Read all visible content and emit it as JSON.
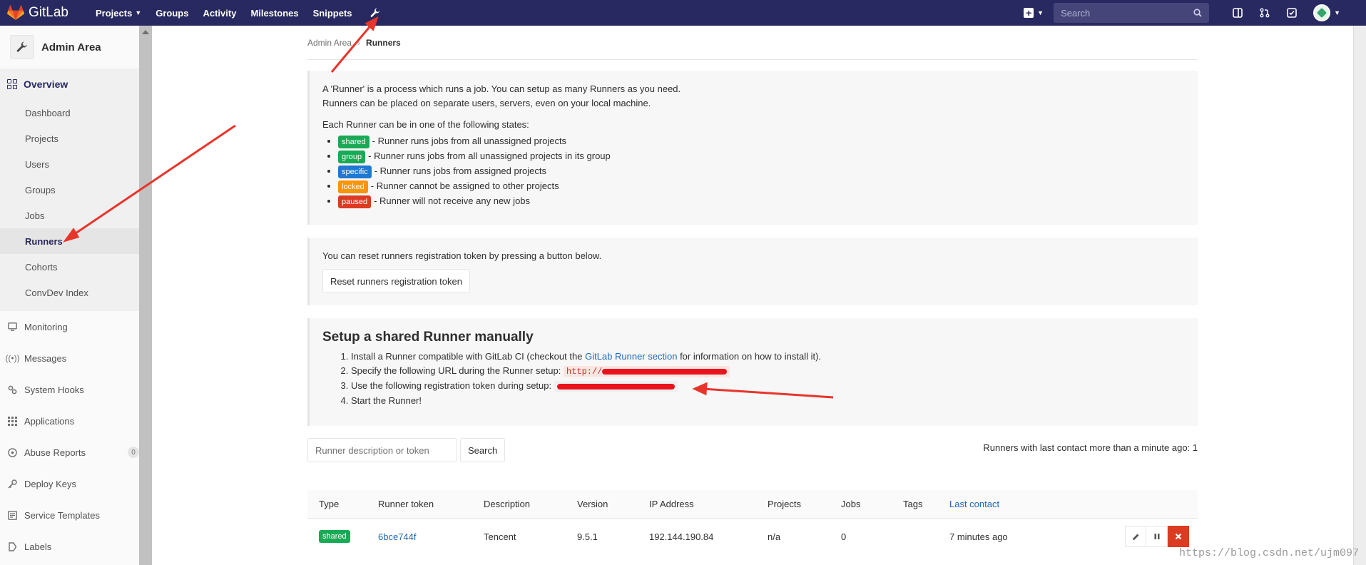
{
  "navbar": {
    "logo_text": "GitLab",
    "links": [
      {
        "label": "Projects",
        "dropdown": true
      },
      {
        "label": "Groups",
        "dropdown": false
      },
      {
        "label": "Activity",
        "dropdown": false
      },
      {
        "label": "Milestones",
        "dropdown": false
      },
      {
        "label": "Snippets",
        "dropdown": false
      }
    ],
    "search_placeholder": "Search"
  },
  "sidebar": {
    "title": "Admin Area",
    "overview_label": "Overview",
    "overview_items": [
      "Dashboard",
      "Projects",
      "Users",
      "Groups",
      "Jobs",
      "Runners",
      "Cohorts",
      "ConvDev Index"
    ],
    "active_item": "Runners",
    "items": [
      {
        "label": "Monitoring",
        "icon": "monitor-icon"
      },
      {
        "label": "Messages",
        "icon": "broadcast-icon"
      },
      {
        "label": "System Hooks",
        "icon": "hook-icon"
      },
      {
        "label": "Applications",
        "icon": "grid-icon"
      },
      {
        "label": "Abuse Reports",
        "icon": "warning-icon",
        "badge": "0"
      },
      {
        "label": "Deploy Keys",
        "icon": "key-icon"
      },
      {
        "label": "Service Templates",
        "icon": "template-icon"
      },
      {
        "label": "Labels",
        "icon": "label-icon"
      }
    ]
  },
  "breadcrumb": {
    "parent": "Admin Area",
    "current": "Runners"
  },
  "intro": {
    "line1": "A 'Runner' is a process which runs a job. You can setup as many Runners as you need.",
    "line2": "Runners can be placed on separate users, servers, even on your local machine.",
    "states_heading": "Each Runner can be in one of the following states:",
    "states": [
      {
        "label": "shared",
        "desc": "- Runner runs jobs from all unassigned projects"
      },
      {
        "label": "group",
        "desc": "- Runner runs jobs from all unassigned projects in its group"
      },
      {
        "label": "specific",
        "desc": "- Runner runs jobs from assigned projects"
      },
      {
        "label": "locked",
        "desc": "- Runner cannot be assigned to other projects"
      },
      {
        "label": "paused",
        "desc": "- Runner will not receive any new jobs"
      }
    ]
  },
  "reset_panel": {
    "text": "You can reset runners registration token by pressing a button below.",
    "button": "Reset runners registration token"
  },
  "setup": {
    "heading": "Setup a shared Runner manually",
    "step1_pre": "Install a Runner compatible with GitLab CI (checkout the",
    "step1_link": "GitLab Runner section",
    "step1_post": "for information on how to install it).",
    "step2": "Specify the following URL during the Runner setup:",
    "step2_code": "http://",
    "step3": "Use the following registration token during setup:",
    "step4": "Start the Runner!"
  },
  "filter": {
    "placeholder": "Runner description or token",
    "button": "Search",
    "contact_note": "Runners with last contact more than a minute ago: 1"
  },
  "table": {
    "columns": [
      "Type",
      "Runner token",
      "Description",
      "Version",
      "IP Address",
      "Projects",
      "Jobs",
      "Tags",
      "Last contact"
    ],
    "rows": [
      {
        "type": "shared",
        "token": "6bce744f",
        "description": "Tencent",
        "version": "9.5.1",
        "ip": "192.144.190.84",
        "projects": "n/a",
        "jobs": "0",
        "tags": "",
        "last_contact": "7 minutes ago"
      }
    ]
  },
  "watermark": "https://blog.csdn.net/ujm097",
  "colors": {
    "navbar": "#292961",
    "accent": "#292961",
    "link": "#1b69b6",
    "arrow": "#e8352b"
  }
}
